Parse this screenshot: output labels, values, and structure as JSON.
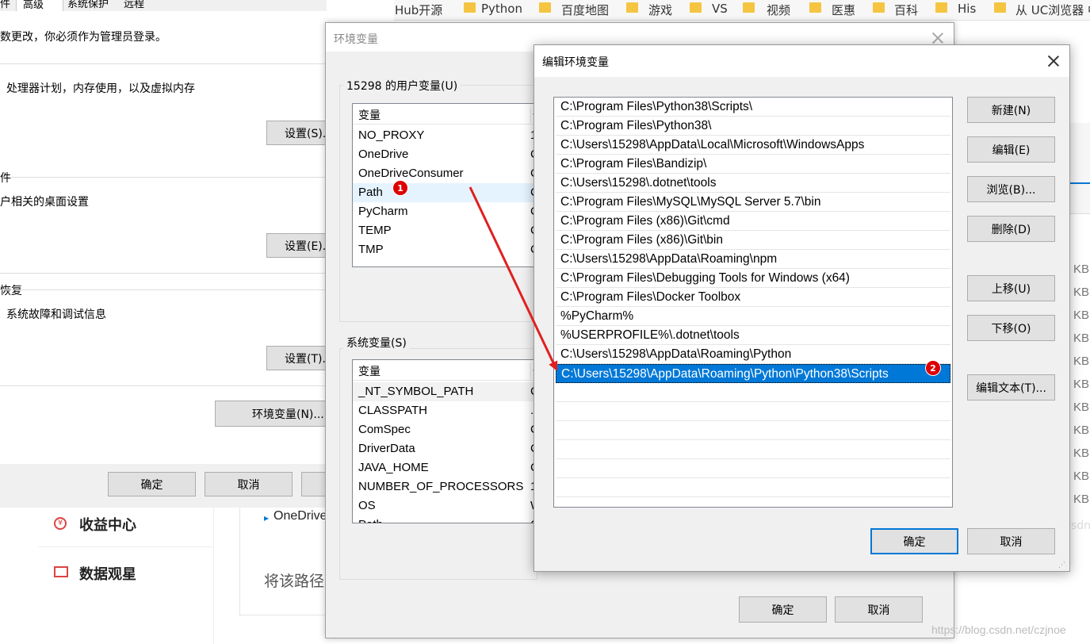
{
  "browser_bookmarks": [
    "Hub开源",
    "Python",
    "百度地图",
    "游戏",
    "VS",
    "视频",
    "医惠",
    "百科",
    "His",
    "从 UC浏览器 中"
  ],
  "system_properties": {
    "tabs": [
      "高级",
      "系统保护",
      "远程"
    ],
    "tab_partial_left": "件",
    "admin_notice": "数更改，你必须作为管理员登录。",
    "performance_desc": "处理器计划，内存使用，以及虚拟内存",
    "settings_s": "设置(S)...",
    "profile_title": "件",
    "profile_desc": "户相关的桌面设置",
    "settings_e": "设置(E)...",
    "recovery_title": "恢复",
    "recovery_desc": "系统故障和调试信息",
    "settings_t": "设置(T)...",
    "env_button": "环境变量(N)...",
    "ok": "确定",
    "cancel": "取消"
  },
  "csdn_background": {
    "menu_income": "收益中心",
    "menu_data": "数据观星",
    "onedrive_label": "OneDrive",
    "path_hint": "将该路径",
    "kb_unit": "KB",
    "kb_count": 11,
    "watermark_partial": "sdn"
  },
  "env_dialog": {
    "title": "环境变量",
    "user_group_title": "15298 的用户变量(U)",
    "user_col_var": "变量",
    "user_col_val": "值",
    "user_vars": [
      {
        "name": "NO_PROXY",
        "val": "1"
      },
      {
        "name": "OneDrive",
        "val": "C"
      },
      {
        "name": "OneDriveConsumer",
        "val": "C"
      },
      {
        "name": "Path",
        "val": "C"
      },
      {
        "name": "PyCharm",
        "val": "C"
      },
      {
        "name": "TEMP",
        "val": "C"
      },
      {
        "name": "TMP",
        "val": "C"
      }
    ],
    "sys_group_title": "系统变量(S)",
    "sys_col_var": "变量",
    "sys_col_val": "值",
    "sys_vars": [
      {
        "name": "_NT_SYMBOL_PATH",
        "val": "C"
      },
      {
        "name": "CLASSPATH",
        "val": ".;"
      },
      {
        "name": "ComSpec",
        "val": "C"
      },
      {
        "name": "DriverData",
        "val": "C"
      },
      {
        "name": "JAVA_HOME",
        "val": "C"
      },
      {
        "name": "NUMBER_OF_PROCESSORS",
        "val": "1"
      },
      {
        "name": "OS",
        "val": "W"
      },
      {
        "name": "Path",
        "val": "C"
      }
    ],
    "ok": "确定",
    "cancel": "取消"
  },
  "edit_dialog": {
    "title": "编辑环境变量",
    "paths": [
      "C:\\Program Files\\Python38\\Scripts\\",
      "C:\\Program Files\\Python38\\",
      "C:\\Users\\15298\\AppData\\Local\\Microsoft\\WindowsApps",
      "C:\\Program Files\\Bandizip\\",
      "C:\\Users\\15298\\.dotnet\\tools",
      "C:\\Program Files\\MySQL\\MySQL Server 5.7\\bin",
      "C:\\Program Files (x86)\\Git\\cmd",
      "C:\\Program Files (x86)\\Git\\bin",
      "C:\\Users\\15298\\AppData\\Roaming\\npm",
      "C:\\Program Files\\Debugging Tools for Windows (x64)",
      "C:\\Program Files\\Docker Toolbox",
      "%PyCharm%",
      "%USERPROFILE%\\.dotnet\\tools",
      "C:\\Users\\15298\\AppData\\Roaming\\Python",
      "C:\\Users\\15298\\AppData\\Roaming\\Python\\Python38\\Scripts"
    ],
    "selected_index": 14,
    "buttons": {
      "new": "新建(N)",
      "edit": "编辑(E)",
      "browse": "浏览(B)...",
      "delete": "删除(D)",
      "move_up": "上移(U)",
      "move_down": "下移(O)",
      "edit_text": "编辑文本(T)..."
    },
    "ok": "确定",
    "cancel": "取消"
  },
  "annotations": {
    "badge1": "1",
    "badge2": "2",
    "arrow_color": "#e02020"
  },
  "watermark": "https://blog.csdn.net/czjnoe",
  "colors": {
    "selection": "#0078d7",
    "dialog_bg": "#f0f0f0",
    "badge": "#dd0000"
  }
}
